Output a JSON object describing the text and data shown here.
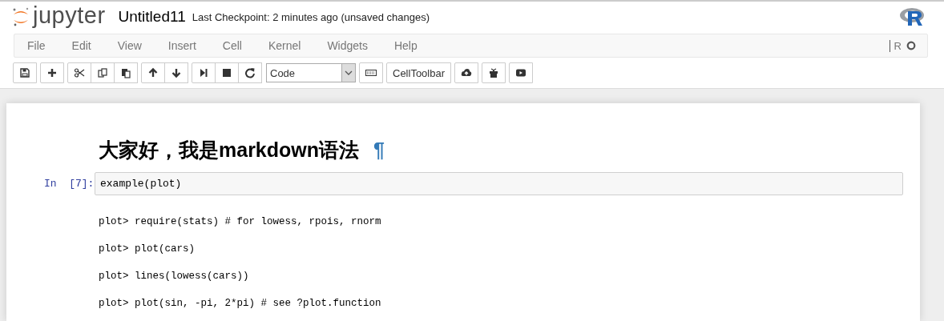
{
  "header": {
    "logo": "jupyter",
    "notebook_name": "Untitled11",
    "checkpoint": "Last Checkpoint: 2 minutes ago (unsaved changes)"
  },
  "menu": [
    "File",
    "Edit",
    "View",
    "Insert",
    "Cell",
    "Kernel",
    "Widgets",
    "Help"
  ],
  "kernel": {
    "name": "R",
    "busy": false
  },
  "toolbar": {
    "groups": [
      [
        {
          "kind": "save"
        }
      ],
      [
        {
          "kind": "add"
        }
      ],
      [
        {
          "kind": "cut"
        },
        {
          "kind": "copy"
        },
        {
          "kind": "paste"
        }
      ],
      [
        {
          "kind": "up"
        },
        {
          "kind": "down"
        }
      ],
      [
        {
          "kind": "run"
        },
        {
          "kind": "stop"
        },
        {
          "kind": "restart"
        }
      ],
      [
        {
          "kind": "select",
          "value": "Code"
        }
      ],
      [
        {
          "kind": "keyboard"
        }
      ],
      [
        {
          "kind": "text",
          "label": "CellToolbar"
        }
      ],
      [
        {
          "kind": "upload"
        }
      ],
      [
        {
          "kind": "box"
        }
      ],
      [
        {
          "kind": "play"
        }
      ]
    ]
  },
  "cells": [
    {
      "kind": "markdown",
      "heading": "大家好，我是markdown语法",
      "anchor": "¶"
    },
    {
      "kind": "code",
      "prompt": "In  [7]:",
      "source": "example(plot)",
      "output": [
        "plot> require(stats) # for lowess, rpois, rnorm",
        "plot> plot(cars)",
        "plot> lines(lowess(cars))",
        "plot> plot(sin, -pi, 2*pi) # see ?plot.function"
      ]
    }
  ]
}
